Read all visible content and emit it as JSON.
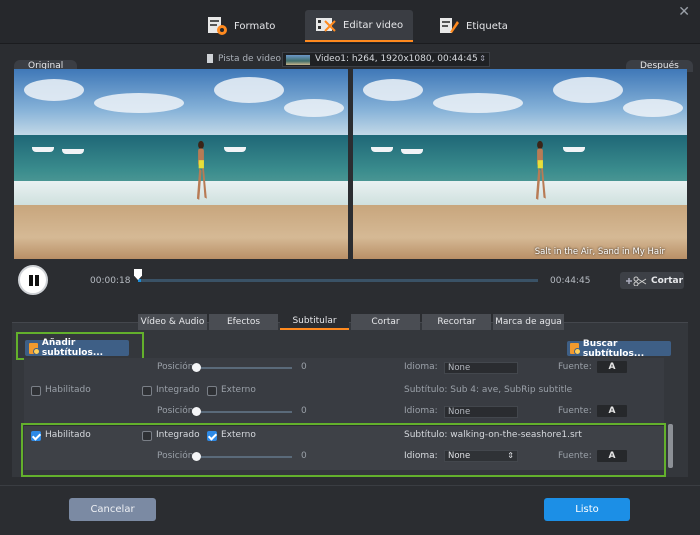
{
  "tabs": [
    {
      "label": "Formato",
      "icon": "format-icon"
    },
    {
      "label": "Editar video",
      "icon": "edit-video-icon"
    },
    {
      "label": "Etiqueta",
      "icon": "tag-icon"
    }
  ],
  "video_track": {
    "label": "Pista de video:",
    "value": "Video1: h264, 1920x1080, 00:44:45"
  },
  "preview": {
    "original_label": "Original",
    "after_label": "Después",
    "subtitle_text": "Salt in the Air, Sand in My Hair"
  },
  "transport": {
    "current_time": "00:00:18",
    "total_time": "00:44:45",
    "progress_fraction": 0.007,
    "cut_label": "Cortar"
  },
  "subtabs": [
    "Vídeo & Audio",
    "Efectos",
    "Subtitular",
    "Cortar",
    "Recortar",
    "Marca de agua"
  ],
  "subtitle_panel": {
    "add_button": "Añadir subtítulos...",
    "find_button": "Buscar subtítulos...",
    "rows": [
      {
        "enabled_label": "Habilitado",
        "enabled": false,
        "integrated_label": "Integrado",
        "integrated": false,
        "external_label": "Externo",
        "external": false,
        "subtitle_label": "Subtítulo: Sub 4: ave, SubRip subtitle",
        "position_label": "Posición:",
        "position_value": "0",
        "language_label": "Idioma:",
        "language_value": "None",
        "font_label": "Fuente:",
        "font_glyph": "A"
      },
      {
        "enabled_label": "Habilitado",
        "enabled": true,
        "integrated_label": "Integrado",
        "integrated": false,
        "external_label": "Externo",
        "external": true,
        "subtitle_label": "Subtítulo: walking-on-the-seashore1.srt",
        "position_label": "Posición:",
        "position_value": "0",
        "language_label": "Idioma:",
        "language_value": "None",
        "font_label": "Fuente:",
        "font_glyph": "A"
      }
    ],
    "partial_row": {
      "position_label": "Posición:",
      "position_value": "0",
      "language_label": "Idioma:",
      "language_value": "None",
      "font_label": "Fuente:",
      "font_glyph": "A"
    }
  },
  "footer": {
    "cancel": "Cancelar",
    "ok": "Listo"
  },
  "colors": {
    "accent": "#ff8a1f",
    "primary_button": "#1c8fe6",
    "highlight": "#63b02c"
  }
}
